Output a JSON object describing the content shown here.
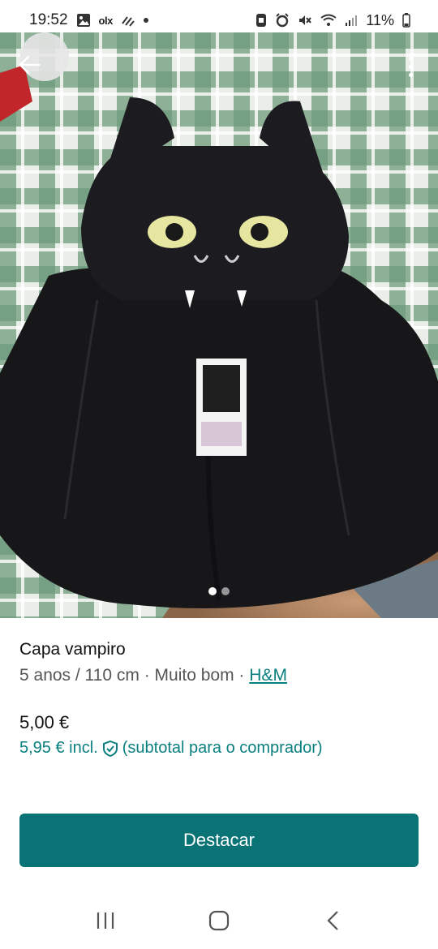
{
  "status_bar": {
    "time": "19:52",
    "left_icons": [
      "gallery-icon",
      "olx-icon",
      "signal-waves-icon",
      "dot-icon"
    ],
    "olx_label": "olx",
    "battery": "11%",
    "right_icons": [
      "lock-app-icon",
      "alarm-icon",
      "mute-icon",
      "wifi-icon",
      "cell-signal-icon",
      "battery-icon"
    ]
  },
  "photo": {
    "pages": 2,
    "active_page": 1
  },
  "item": {
    "title": "Capa vampiro",
    "size": "5 anos / 110 cm",
    "separator": " · ",
    "condition": "Muito bom",
    "brand": "H&M",
    "price": "5,00 €",
    "price_incl": "5,95 € incl.",
    "price_incl_note": "(subtotal para o comprador)"
  },
  "cta": {
    "label": "Destacar"
  },
  "colors": {
    "accent": "#0a7376",
    "link": "#0a7f80"
  }
}
